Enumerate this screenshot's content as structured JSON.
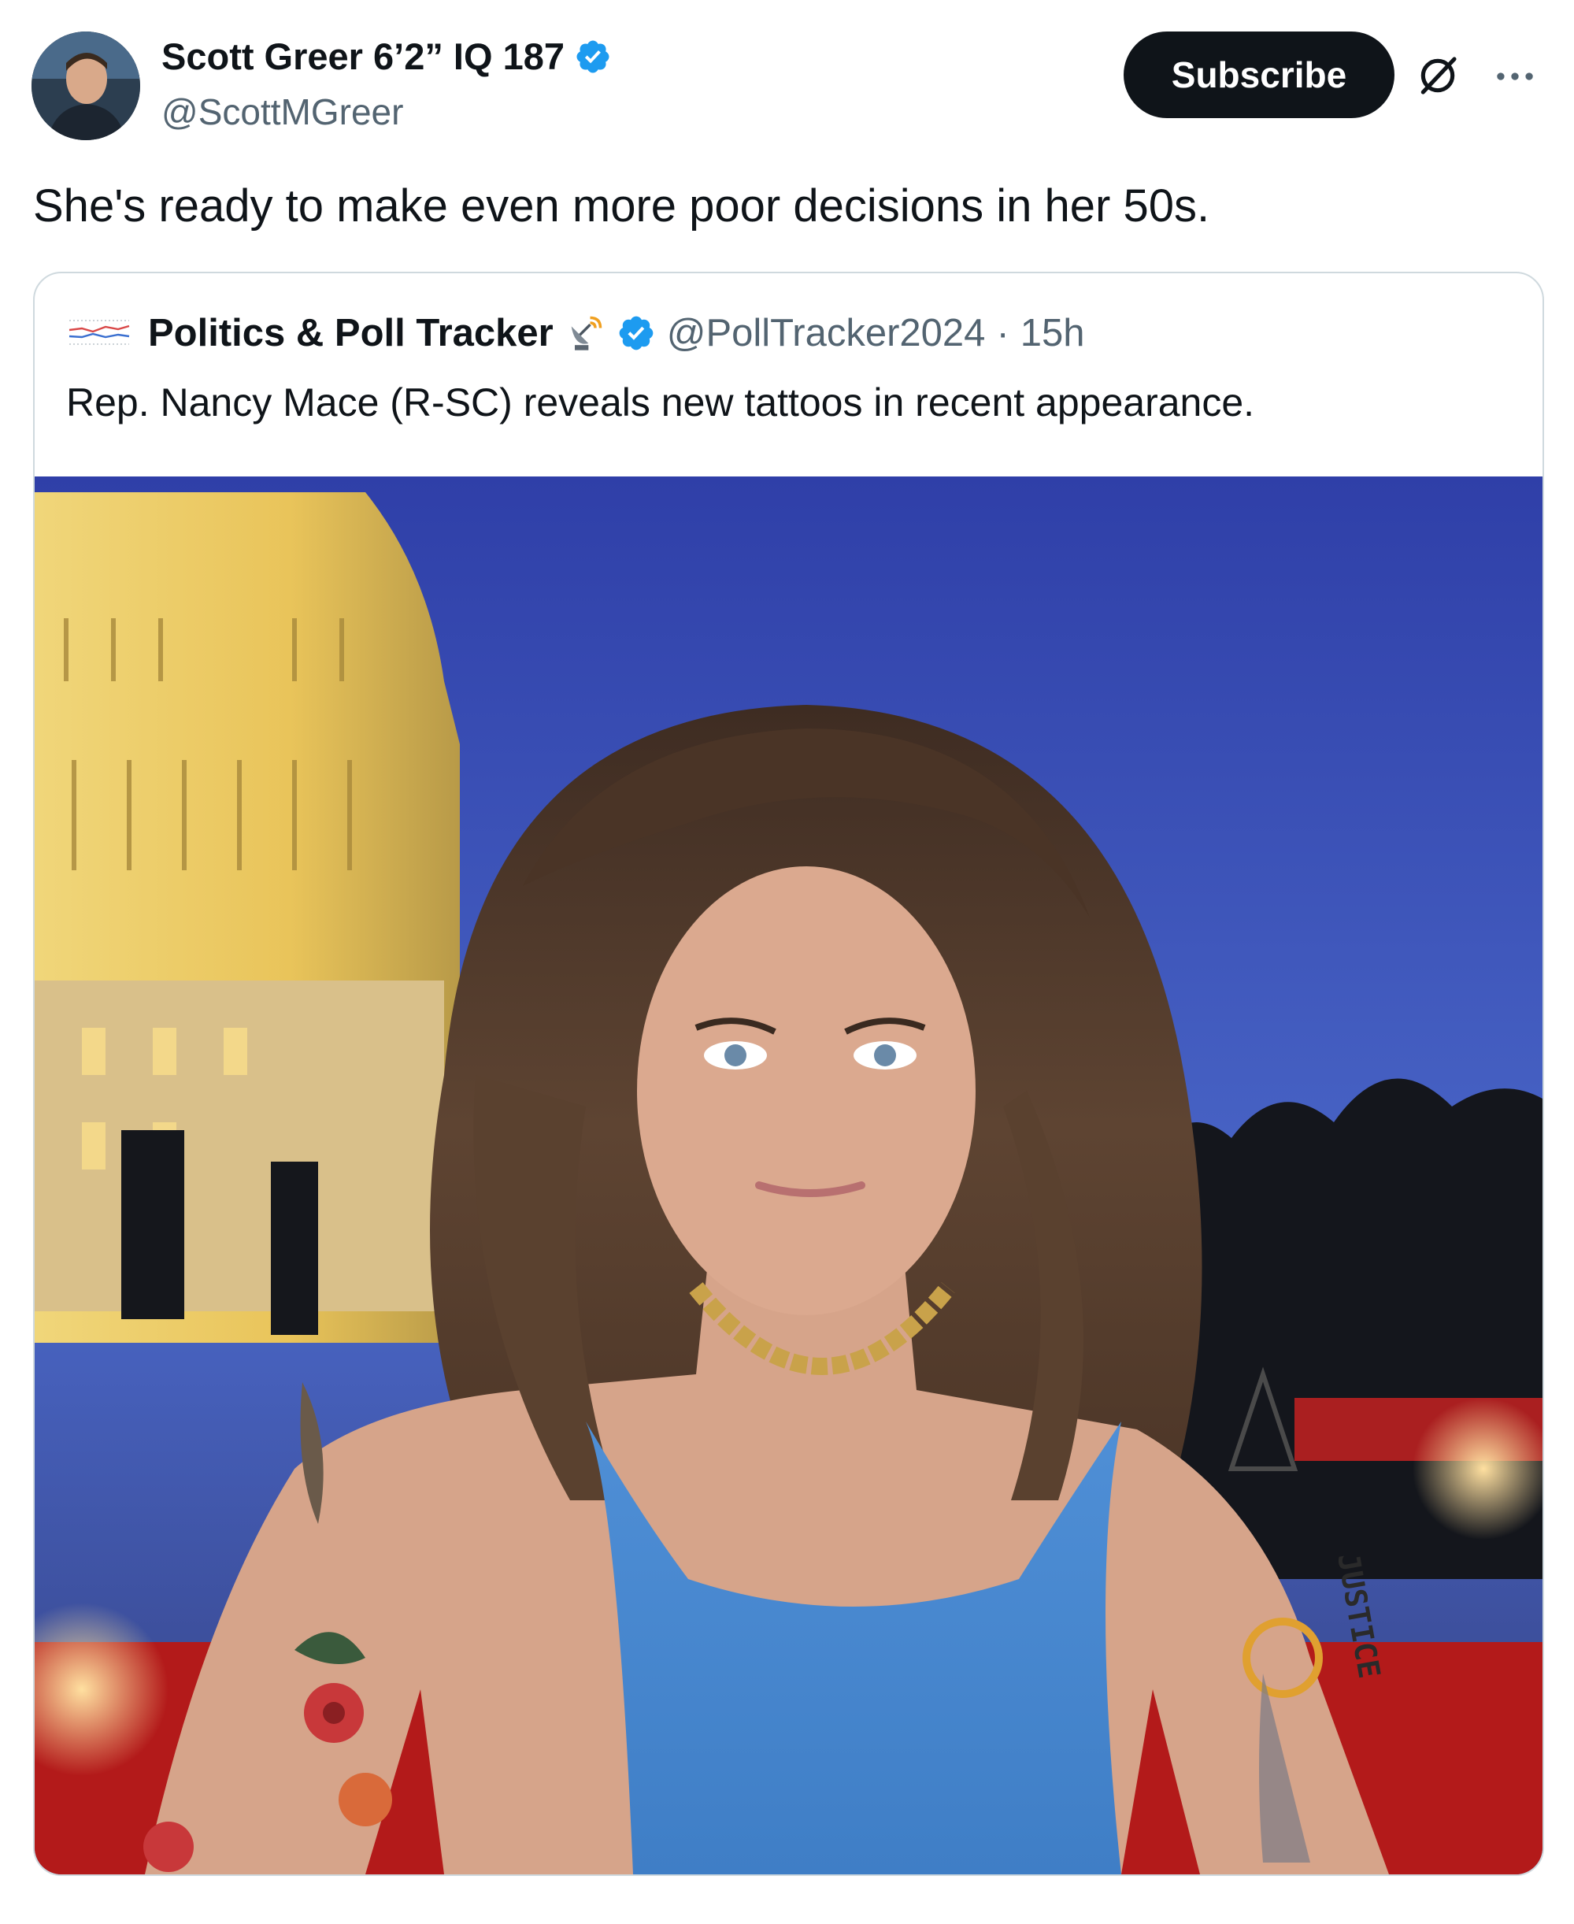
{
  "tweet": {
    "author": {
      "name": "Scott Greer 6’2” IQ 187",
      "handle": "@ScottMGreer",
      "verified": true
    },
    "subscribe_label": "Subscribe",
    "text": "She's ready to make even more poor decisions in her 50s.",
    "icons": [
      "grok-icon",
      "more-icon",
      "verified-badge-icon"
    ]
  },
  "quoted": {
    "author": {
      "name": "Politics & Poll Tracker",
      "handle": "@PollTracker2024",
      "verified": true
    },
    "dot": "·",
    "time": "15h",
    "text": "Rep. Nancy Mace (R-SC) reveals new tattoos in recent appearance.",
    "image": {
      "tattoo_text": "JUSTICE"
    }
  },
  "colors": {
    "text_primary": "#0f1419",
    "text_secondary": "#536471",
    "verified_blue": "#1d9bf0",
    "border": "#cfd9de",
    "button_bg": "#0f1419"
  }
}
